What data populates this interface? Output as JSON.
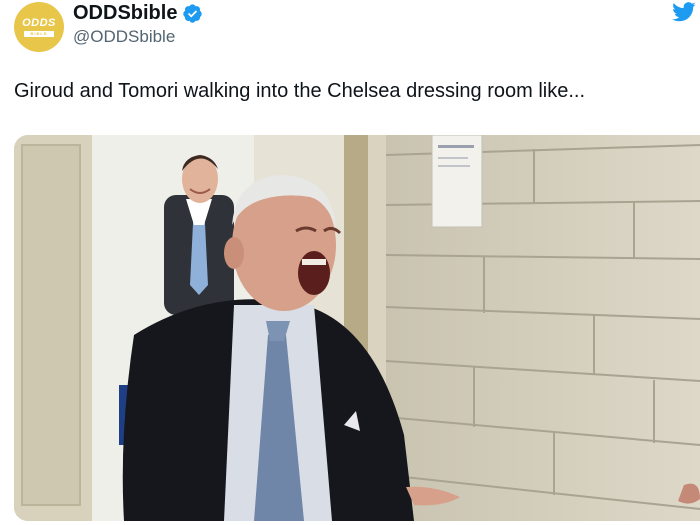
{
  "account": {
    "avatar_text": "ODDS",
    "avatar_subtext": "BIBLE",
    "display_name": "ODDSbible",
    "handle": "@ODDSbible",
    "verified": true
  },
  "tweet": {
    "text": "Giroud and Tomori walking into the Chelsea dressing room like..."
  },
  "colors": {
    "brand_yellow": "#e8c64a",
    "verified_blue": "#1d9bf0",
    "twitter_blue": "#1d9bf0",
    "handle_gray": "#536471"
  },
  "icons": {
    "verified": "verified-badge-icon",
    "platform": "twitter-bird-icon"
  }
}
